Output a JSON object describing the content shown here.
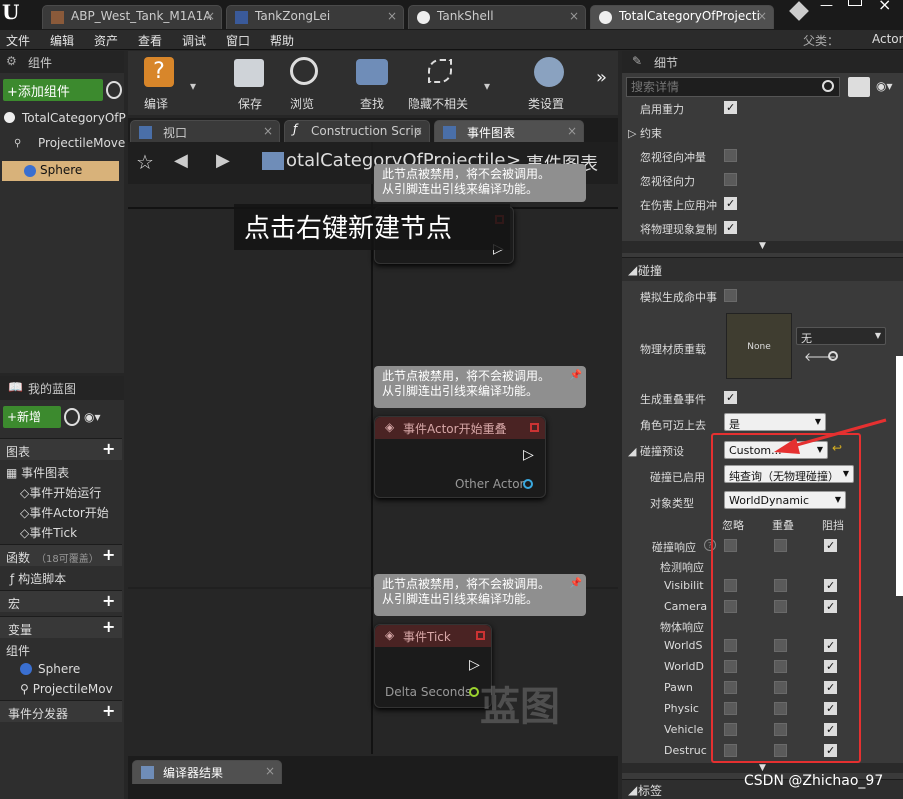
{
  "tabs": [
    "ABP_West_Tank_M1A1A",
    "TankZongLei",
    "TankShell",
    "TotalCategoryOfProjecti"
  ],
  "menu": [
    "文件",
    "编辑",
    "资产",
    "查看",
    "调试",
    "窗口",
    "帮助"
  ],
  "parent_label": "父类：",
  "parent_value": "Actor",
  "components_title": "组件",
  "add_component": "+添加组件",
  "comp_root": "TotalCategoryOfP",
  "comp_items": [
    "ProjectileMove",
    "Sphere"
  ],
  "toolbar": [
    "编译",
    "保存",
    "浏览",
    "查找",
    "隐藏不相关",
    "类设置"
  ],
  "doc_tabs": [
    "视口",
    "Construction Scrip",
    "事件图表"
  ],
  "breadcrumb_class": "otalCategoryOfProjectile",
  "breadcrumb_sep": ">",
  "breadcrumb_page": "事件图表",
  "hint": "点击右键新建节点",
  "disabled_note_1": "此节点被禁用，将不会被调用。",
  "disabled_note_2": "从引脚连出引线来编译功能。",
  "node_overlap": "事件Actor开始重叠",
  "pin_other": "Other Actor",
  "node_tick": "事件Tick",
  "pin_delta": "Delta Seconds",
  "watermark": "蓝图",
  "mybp_title": "我的蓝图",
  "new_btn": "+新增",
  "bp_graph": "图表",
  "bp_event_graph": "事件图表",
  "bp_events": [
    "事件开始运行",
    "事件Actor开始",
    "事件Tick"
  ],
  "bp_functions": "函数",
  "bp_functions_count": "（18可覆盖）",
  "bp_construct": "构造脚本",
  "bp_macros": "宏",
  "bp_vars": "变量",
  "bp_comp": "组件",
  "bp_comp_items": [
    "Sphere",
    "ProjectileMov"
  ],
  "bp_dispatch": "事件分发器",
  "compiler": "编译器结果",
  "details_title": "细节",
  "search_ph": "搜索详情",
  "d_gravity": "启用重力",
  "d_constraints": "约束",
  "d_ignore_impulse": "忽视径向冲量",
  "d_ignore_force": "忽视径向力",
  "d_apply_damage": "在伤害上应用冲",
  "d_replicate": "将物理现象复制",
  "sec_collision": "碰撞",
  "d_sim_hit": "模拟生成命中事",
  "d_phys_mat": "物理材质重载",
  "mat_none": "None",
  "mat_value": "无",
  "d_gen_overlap": "生成重叠事件",
  "d_step_on": "角色可迈上去",
  "step_on_value": "是",
  "d_preset": "碰撞预设",
  "preset_value": "Custom...",
  "d_enabled": "碰撞已启用",
  "enabled_value": "纯查询（无物理碰撞）",
  "d_obj_type": "对象类型",
  "obj_type_value": "WorldDynamic",
  "col_ignore": "忽略",
  "col_overlap": "重叠",
  "col_block": "阻挡",
  "d_response": "碰撞响应",
  "d_trace": "检测响应",
  "d_object": "物体响应",
  "trace_rows": [
    "Visibilit",
    "Camera"
  ],
  "object_rows": [
    "WorldS",
    "WorldD",
    "Pawn",
    "Physic",
    "Vehicle",
    "Destruc"
  ],
  "sec_tags": "标签",
  "credit": "CSDN @Zhichao_97"
}
